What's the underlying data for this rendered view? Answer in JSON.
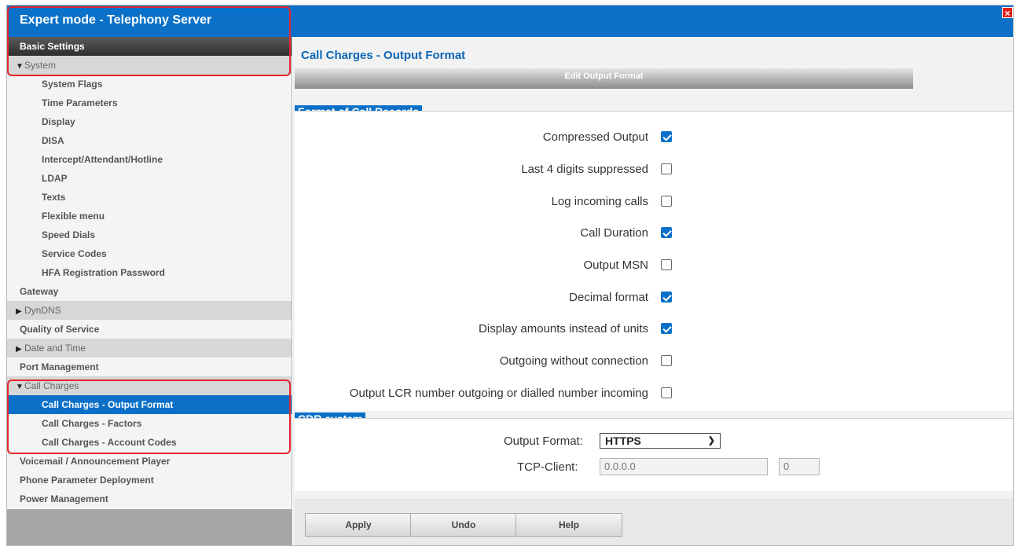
{
  "window": {
    "title": "Expert mode - Telephony Server",
    "close_label": "×"
  },
  "sidebar": {
    "header": "Basic Settings",
    "items": [
      {
        "label": "System",
        "tri": "▼"
      },
      {
        "label": "System Flags"
      },
      {
        "label": "Time Parameters"
      },
      {
        "label": "Display"
      },
      {
        "label": "DISA"
      },
      {
        "label": "Intercept/Attendant/Hotline"
      },
      {
        "label": "LDAP"
      },
      {
        "label": "Texts"
      },
      {
        "label": "Flexible menu"
      },
      {
        "label": "Speed Dials"
      },
      {
        "label": "Service Codes"
      },
      {
        "label": "HFA Registration Password"
      },
      {
        "label": "Gateway"
      },
      {
        "label": "DynDNS",
        "tri": "▶"
      },
      {
        "label": "Quality of Service"
      },
      {
        "label": "Date and Time",
        "tri": "▶"
      },
      {
        "label": "Port Management"
      },
      {
        "label": "Call Charges",
        "tri": "▼"
      },
      {
        "label": "Call Charges - Output Format"
      },
      {
        "label": "Call Charges - Factors"
      },
      {
        "label": "Call Charges - Account Codes"
      },
      {
        "label": "Voicemail / Announcement Player"
      },
      {
        "label": "Phone Parameter Deployment"
      },
      {
        "label": "Power Management"
      }
    ]
  },
  "main": {
    "title": "Call Charges - Output Format",
    "subtitle": "Edit Output Format",
    "format_section": {
      "title": "Format of Call Records",
      "rows": [
        {
          "label": "Compressed Output",
          "checked": true
        },
        {
          "label": "Last 4 digits suppressed",
          "checked": false
        },
        {
          "label": "Log incoming calls",
          "checked": false
        },
        {
          "label": "Call Duration",
          "checked": true
        },
        {
          "label": "Output MSN",
          "checked": false
        },
        {
          "label": "Decimal format",
          "checked": true
        },
        {
          "label": "Display amounts instead of units",
          "checked": true
        },
        {
          "label": "Outgoing without connection",
          "checked": false
        },
        {
          "label": "Output LCR number outgoing or dialled number incoming",
          "checked": false
        }
      ]
    },
    "cdr_section": {
      "title": "CDR system",
      "output_format_label": "Output Format:",
      "output_format_value": "HTTPS",
      "tcp_label": "TCP-Client:",
      "tcp_ip": "0.0.0.0",
      "tcp_port": "0"
    },
    "buttons": {
      "apply": "Apply",
      "undo": "Undo",
      "help": "Help"
    }
  }
}
